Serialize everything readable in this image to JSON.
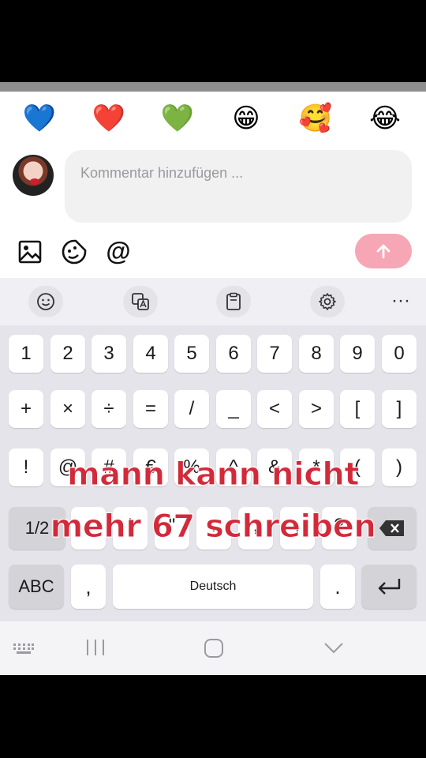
{
  "emoji_bar": [
    "💙",
    "❤️",
    "💚",
    "😁",
    "🥰",
    "😂"
  ],
  "comment": {
    "placeholder": "Kommentar hinzufügen ...",
    "value": ""
  },
  "toolbar_icons": [
    "image-icon",
    "sticker-icon",
    "at-icon"
  ],
  "at_symbol": "@",
  "keyboard": {
    "toolbar": [
      "emoji-icon",
      "translate-icon",
      "clipboard-icon",
      "settings-icon",
      "more-icon"
    ],
    "more_label": "···",
    "row1": [
      "1",
      "2",
      "3",
      "4",
      "5",
      "6",
      "7",
      "8",
      "9",
      "0"
    ],
    "row2": [
      "+",
      "×",
      "÷",
      "=",
      "/",
      "_",
      "<",
      ">",
      "[",
      "]"
    ],
    "row3": [
      "!",
      "@",
      "#",
      "€",
      "%",
      "^",
      "&",
      "*",
      "(",
      ")"
    ],
    "row4": [
      "-",
      "'",
      "\"",
      ":",
      ";",
      ",",
      "?"
    ],
    "shift_label": "1/2",
    "abc_label": "ABC",
    "comma_label": ",",
    "space_label": "Deutsch",
    "period_label": "."
  },
  "overlay_text": {
    "line1": "mann kann nicht",
    "line2": "mehr 67 schreiben"
  },
  "nav": [
    "keyboard-hide-icon",
    "recents-icon",
    "home-icon",
    "back-icon"
  ]
}
